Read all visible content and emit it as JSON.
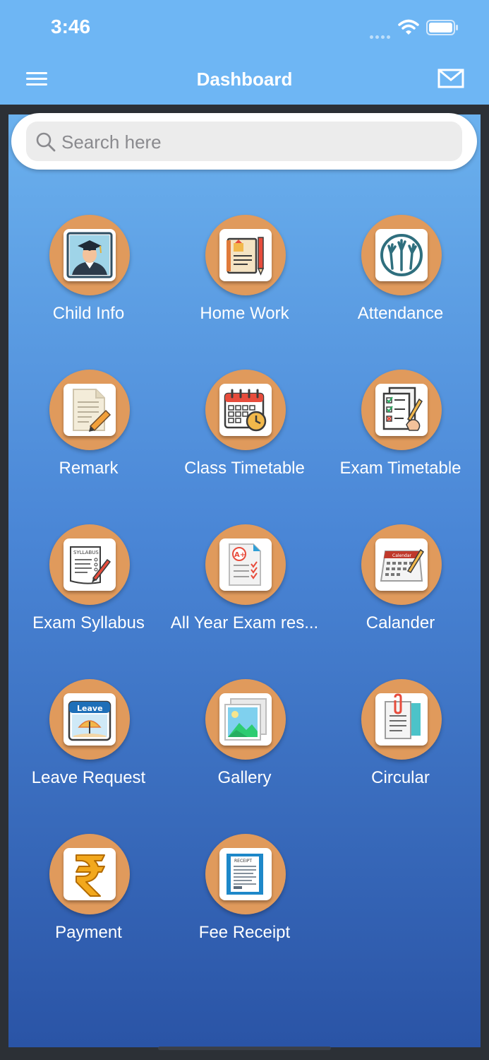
{
  "status_bar": {
    "time": "3:46"
  },
  "header": {
    "title": "Dashboard",
    "menu_icon": "hamburger-menu-icon",
    "mail_icon": "envelope-icon"
  },
  "search": {
    "placeholder": "Search here",
    "value": "",
    "icon": "magnifier-icon"
  },
  "colors": {
    "header_bg": "#6eb6f4",
    "tile_circle": "#e09a5c",
    "background_gradient_top": "#6bb1ee",
    "background_gradient_bottom": "#2a54a6",
    "label_text": "#ffffff"
  },
  "tiles": [
    {
      "label": "Child Info",
      "icon": "graduate-student-icon"
    },
    {
      "label": "Home Work",
      "icon": "notebook-pencil-icon"
    },
    {
      "label": "Attendance",
      "icon": "raised-hands-icon"
    },
    {
      "label": "Remark",
      "icon": "note-pencil-icon"
    },
    {
      "label": "Class Timetable",
      "icon": "calendar-clock-icon"
    },
    {
      "label": "Exam Timetable",
      "icon": "checklist-hand-icon"
    },
    {
      "label": "Exam Syllabus",
      "icon": "syllabus-document-icon"
    },
    {
      "label": "All Year Exam res...",
      "icon": "exam-result-a-plus-icon"
    },
    {
      "label": "Calander",
      "icon": "desk-calendar-icon"
    },
    {
      "label": "Leave Request",
      "icon": "leave-calendar-icon"
    },
    {
      "label": "Gallery",
      "icon": "photo-gallery-icon"
    },
    {
      "label": "Circular",
      "icon": "clipboard-circular-icon"
    },
    {
      "label": "Payment",
      "icon": "rupee-icon"
    },
    {
      "label": "Fee Receipt",
      "icon": "receipt-icon"
    }
  ],
  "icon_text": {
    "leave_badge": "Leave",
    "calendar_badge": "Calendar",
    "receipt_badge": "RECEIPT",
    "syllabus_badge": "SYLLABUS"
  }
}
